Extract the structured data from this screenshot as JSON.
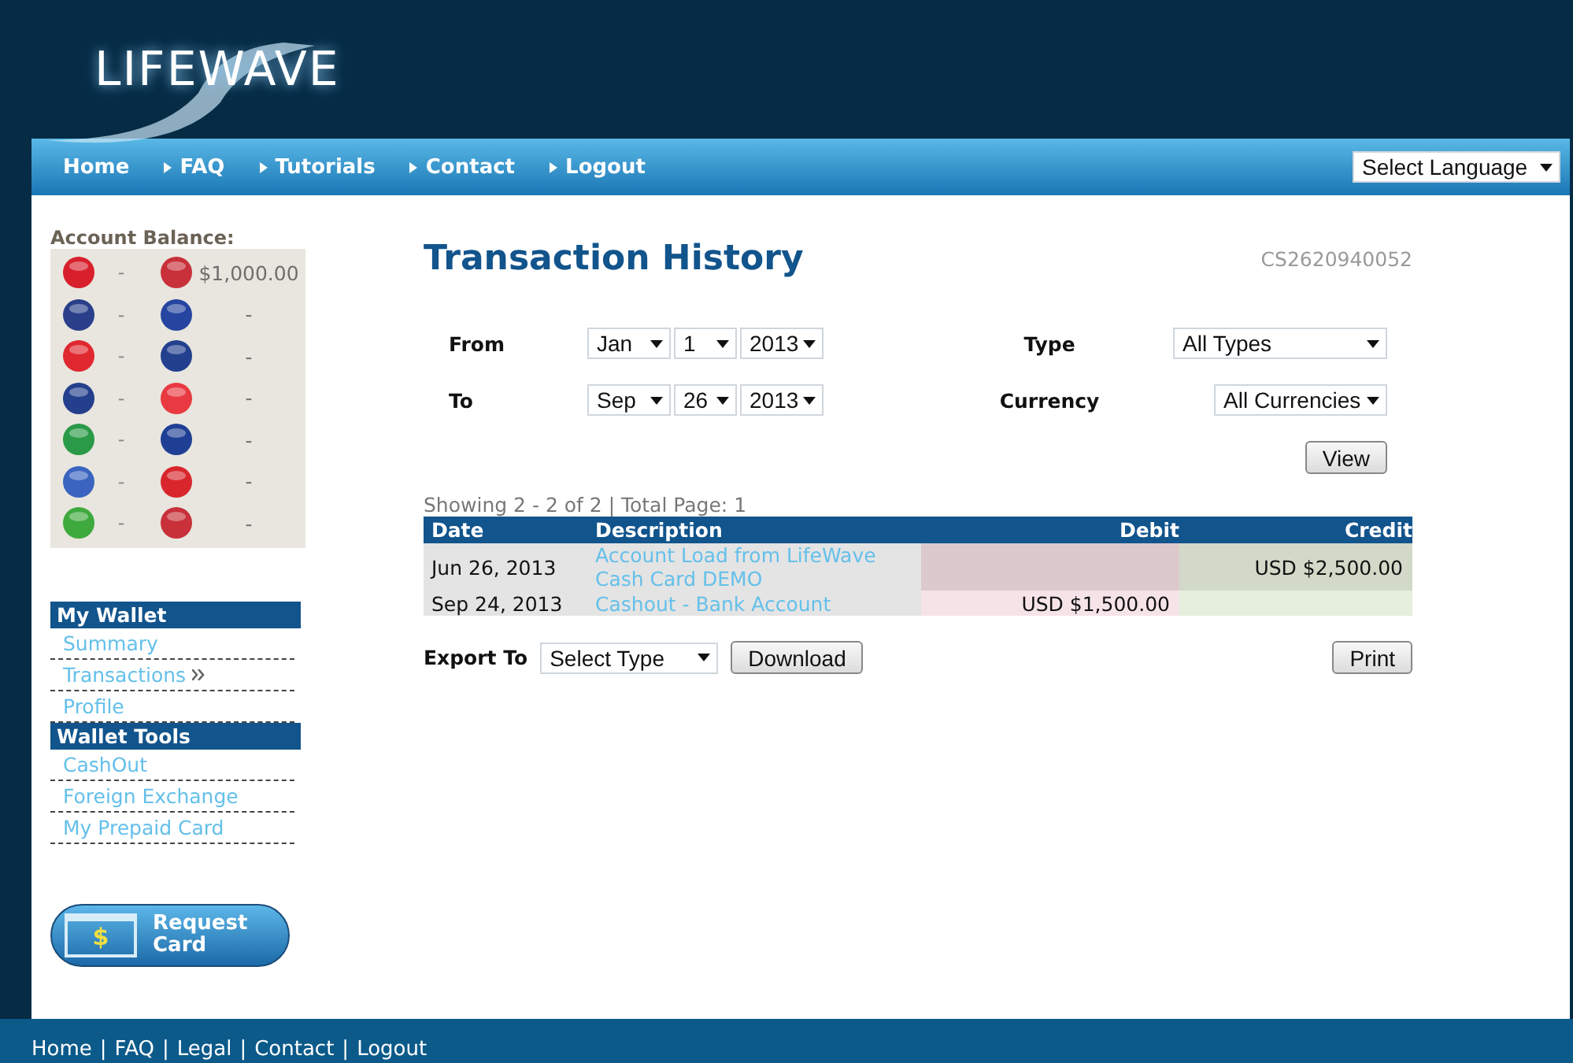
{
  "header": {
    "logo": "LIFEWAVE"
  },
  "nav": {
    "items": [
      {
        "label": "Home",
        "arrow": false
      },
      {
        "label": "FAQ",
        "arrow": true
      },
      {
        "label": "Tutorials",
        "arrow": true
      },
      {
        "label": "Contact",
        "arrow": true
      },
      {
        "label": "Logout",
        "arrow": true
      }
    ],
    "language": "Select Language"
  },
  "balance": {
    "title": "Account Balance:",
    "rows": [
      {
        "left": {
          "color": "#d8202c",
          "amount": "-"
        },
        "right": {
          "color": "#c8303a",
          "amount": "$1,000.00"
        }
      },
      {
        "left": {
          "color": "#2a3f8a",
          "amount": "-"
        },
        "right": {
          "color": "#2545a0",
          "amount": "-"
        }
      },
      {
        "left": {
          "color": "#e02830",
          "amount": "-"
        },
        "right": {
          "color": "#23408f",
          "amount": "-"
        }
      },
      {
        "left": {
          "color": "#243f8c",
          "amount": "-"
        },
        "right": {
          "color": "#e83a40",
          "amount": "-"
        }
      },
      {
        "left": {
          "color": "#2a9a48",
          "amount": "-"
        },
        "right": {
          "color": "#1f3f95",
          "amount": "-"
        }
      },
      {
        "left": {
          "color": "#3a64c0",
          "amount": "-"
        },
        "right": {
          "color": "#d8262c",
          "amount": "-"
        }
      },
      {
        "left": {
          "color": "#3eaa3e",
          "amount": "-"
        },
        "right": {
          "color": "#c8303a",
          "amount": "-"
        }
      }
    ]
  },
  "menus": [
    {
      "title": "My Wallet",
      "items": [
        {
          "label": "Summary",
          "selected": false
        },
        {
          "label": "Transactions",
          "selected": true
        },
        {
          "label": "Profile",
          "selected": false
        }
      ]
    },
    {
      "title": "Wallet Tools",
      "items": [
        {
          "label": "CashOut",
          "selected": false
        },
        {
          "label": "Foreign Exchange",
          "selected": false
        },
        {
          "label": "My Prepaid Card",
          "selected": false
        }
      ]
    }
  ],
  "request_button": {
    "symbol": "$",
    "label": "Request Card"
  },
  "page": {
    "title": "Transaction History",
    "account_id": "CS2620940052"
  },
  "filters": {
    "from_label": "From",
    "from": [
      "Jan",
      "1",
      "2013"
    ],
    "to_label": "To",
    "to": [
      "Sep",
      "26",
      "2013"
    ],
    "type_label": "Type",
    "type": "All Types",
    "currency_label": "Currency",
    "currency": "All Currencies",
    "view_button": "View"
  },
  "table": {
    "summary": "Showing 2 - 2 of 2 | Total Page: 1",
    "columns": [
      "Date",
      "Description",
      "Debit",
      "Credit"
    ],
    "rows": [
      {
        "date": "Jun 26, 2013",
        "description": "Account Load from LifeWave Cash Card DEMO",
        "debit": "",
        "credit": "USD $2,500.00"
      },
      {
        "date": "Sep 24, 2013",
        "description": "Cashout - Bank Account",
        "debit": "USD $1,500.00",
        "credit": ""
      }
    ]
  },
  "export": {
    "label": "Export To",
    "select": "Select Type",
    "download": "Download",
    "print": "Print"
  },
  "footer": {
    "links": [
      "Home",
      "FAQ",
      "Legal",
      "Contact",
      "Logout"
    ],
    "separator": "|"
  }
}
